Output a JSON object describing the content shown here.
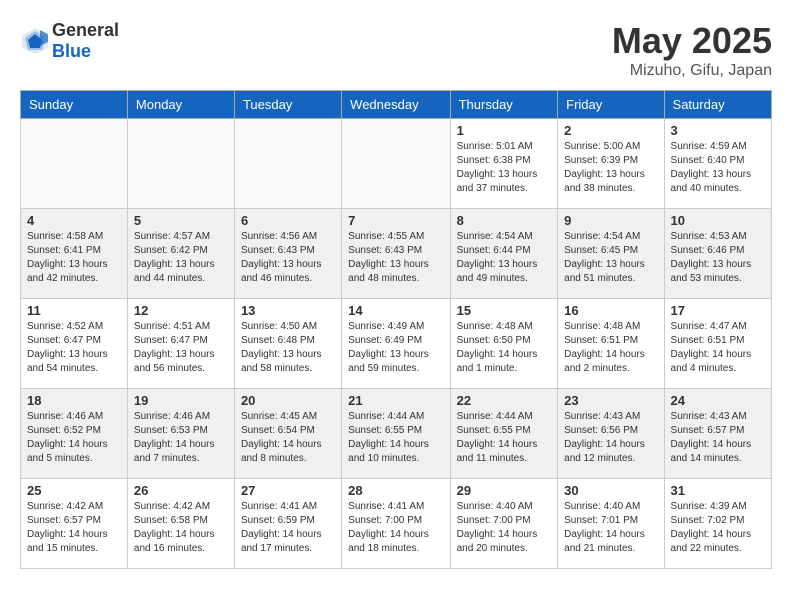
{
  "header": {
    "logo_general": "General",
    "logo_blue": "Blue",
    "month_title": "May 2025",
    "location": "Mizuho, Gifu, Japan"
  },
  "calendar": {
    "headers": [
      "Sunday",
      "Monday",
      "Tuesday",
      "Wednesday",
      "Thursday",
      "Friday",
      "Saturday"
    ],
    "weeks": [
      [
        {
          "day": "",
          "info": ""
        },
        {
          "day": "",
          "info": ""
        },
        {
          "day": "",
          "info": ""
        },
        {
          "day": "",
          "info": ""
        },
        {
          "day": "1",
          "info": "Sunrise: 5:01 AM\nSunset: 6:38 PM\nDaylight: 13 hours\nand 37 minutes."
        },
        {
          "day": "2",
          "info": "Sunrise: 5:00 AM\nSunset: 6:39 PM\nDaylight: 13 hours\nand 38 minutes."
        },
        {
          "day": "3",
          "info": "Sunrise: 4:59 AM\nSunset: 6:40 PM\nDaylight: 13 hours\nand 40 minutes."
        }
      ],
      [
        {
          "day": "4",
          "info": "Sunrise: 4:58 AM\nSunset: 6:41 PM\nDaylight: 13 hours\nand 42 minutes."
        },
        {
          "day": "5",
          "info": "Sunrise: 4:57 AM\nSunset: 6:42 PM\nDaylight: 13 hours\nand 44 minutes."
        },
        {
          "day": "6",
          "info": "Sunrise: 4:56 AM\nSunset: 6:43 PM\nDaylight: 13 hours\nand 46 minutes."
        },
        {
          "day": "7",
          "info": "Sunrise: 4:55 AM\nSunset: 6:43 PM\nDaylight: 13 hours\nand 48 minutes."
        },
        {
          "day": "8",
          "info": "Sunrise: 4:54 AM\nSunset: 6:44 PM\nDaylight: 13 hours\nand 49 minutes."
        },
        {
          "day": "9",
          "info": "Sunrise: 4:54 AM\nSunset: 6:45 PM\nDaylight: 13 hours\nand 51 minutes."
        },
        {
          "day": "10",
          "info": "Sunrise: 4:53 AM\nSunset: 6:46 PM\nDaylight: 13 hours\nand 53 minutes."
        }
      ],
      [
        {
          "day": "11",
          "info": "Sunrise: 4:52 AM\nSunset: 6:47 PM\nDaylight: 13 hours\nand 54 minutes."
        },
        {
          "day": "12",
          "info": "Sunrise: 4:51 AM\nSunset: 6:47 PM\nDaylight: 13 hours\nand 56 minutes."
        },
        {
          "day": "13",
          "info": "Sunrise: 4:50 AM\nSunset: 6:48 PM\nDaylight: 13 hours\nand 58 minutes."
        },
        {
          "day": "14",
          "info": "Sunrise: 4:49 AM\nSunset: 6:49 PM\nDaylight: 13 hours\nand 59 minutes."
        },
        {
          "day": "15",
          "info": "Sunrise: 4:48 AM\nSunset: 6:50 PM\nDaylight: 14 hours\nand 1 minute."
        },
        {
          "day": "16",
          "info": "Sunrise: 4:48 AM\nSunset: 6:51 PM\nDaylight: 14 hours\nand 2 minutes."
        },
        {
          "day": "17",
          "info": "Sunrise: 4:47 AM\nSunset: 6:51 PM\nDaylight: 14 hours\nand 4 minutes."
        }
      ],
      [
        {
          "day": "18",
          "info": "Sunrise: 4:46 AM\nSunset: 6:52 PM\nDaylight: 14 hours\nand 5 minutes."
        },
        {
          "day": "19",
          "info": "Sunrise: 4:46 AM\nSunset: 6:53 PM\nDaylight: 14 hours\nand 7 minutes."
        },
        {
          "day": "20",
          "info": "Sunrise: 4:45 AM\nSunset: 6:54 PM\nDaylight: 14 hours\nand 8 minutes."
        },
        {
          "day": "21",
          "info": "Sunrise: 4:44 AM\nSunset: 6:55 PM\nDaylight: 14 hours\nand 10 minutes."
        },
        {
          "day": "22",
          "info": "Sunrise: 4:44 AM\nSunset: 6:55 PM\nDaylight: 14 hours\nand 11 minutes."
        },
        {
          "day": "23",
          "info": "Sunrise: 4:43 AM\nSunset: 6:56 PM\nDaylight: 14 hours\nand 12 minutes."
        },
        {
          "day": "24",
          "info": "Sunrise: 4:43 AM\nSunset: 6:57 PM\nDaylight: 14 hours\nand 14 minutes."
        }
      ],
      [
        {
          "day": "25",
          "info": "Sunrise: 4:42 AM\nSunset: 6:57 PM\nDaylight: 14 hours\nand 15 minutes."
        },
        {
          "day": "26",
          "info": "Sunrise: 4:42 AM\nSunset: 6:58 PM\nDaylight: 14 hours\nand 16 minutes."
        },
        {
          "day": "27",
          "info": "Sunrise: 4:41 AM\nSunset: 6:59 PM\nDaylight: 14 hours\nand 17 minutes."
        },
        {
          "day": "28",
          "info": "Sunrise: 4:41 AM\nSunset: 7:00 PM\nDaylight: 14 hours\nand 18 minutes."
        },
        {
          "day": "29",
          "info": "Sunrise: 4:40 AM\nSunset: 7:00 PM\nDaylight: 14 hours\nand 20 minutes."
        },
        {
          "day": "30",
          "info": "Sunrise: 4:40 AM\nSunset: 7:01 PM\nDaylight: 14 hours\nand 21 minutes."
        },
        {
          "day": "31",
          "info": "Sunrise: 4:39 AM\nSunset: 7:02 PM\nDaylight: 14 hours\nand 22 minutes."
        }
      ]
    ]
  }
}
